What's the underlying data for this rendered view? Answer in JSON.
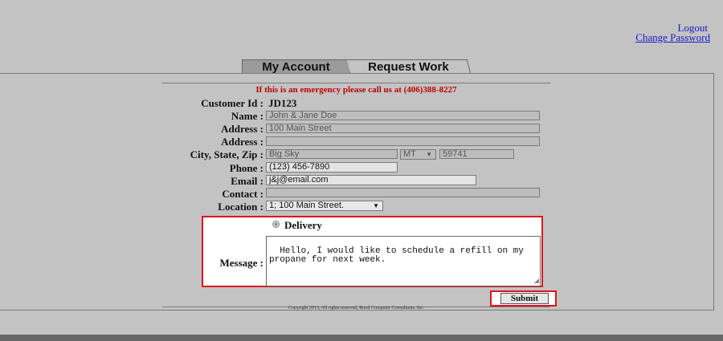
{
  "top_links": {
    "logout": "Logout",
    "change_password": "Change Password"
  },
  "tabs": [
    {
      "label": "My Account",
      "active": false
    },
    {
      "label": "Request Work",
      "active": true
    }
  ],
  "emergency_notice": "If this is an emergency please call us at (406)388-8227",
  "form": {
    "customer_id": {
      "label": "Customer Id :",
      "value": "JD123"
    },
    "name": {
      "label": "Name :",
      "value": "John & Jane Doe"
    },
    "address1": {
      "label": "Address :",
      "value": "100 Main Street"
    },
    "address2": {
      "label": "Address :",
      "value": ""
    },
    "city_state_zip": {
      "label": "City, State, Zip :",
      "city": "Big Sky",
      "state": "MT",
      "zip": "59741"
    },
    "phone": {
      "label": "Phone :",
      "value": "(123) 456-7890"
    },
    "email": {
      "label": "Email :",
      "value": "j&j@email.com"
    },
    "contact": {
      "label": "Contact :",
      "value": ""
    },
    "location": {
      "label": "Location :",
      "value": "1; 100 Main Street."
    },
    "service_type": {
      "label": "Delivery",
      "selected": true
    },
    "message": {
      "label": "Message :",
      "value": "Hello, I would like to schedule a refill on my\npropane for next week."
    }
  },
  "submit_label": "Submit",
  "copyright": "Copyright 2013, All rights reserved, Rural Computer Consultants, Inc.",
  "colors": {
    "background": "#c3c3c3",
    "emergency": "#c00000",
    "highlight": "#e0141c",
    "link": "#1a1ac8"
  },
  "icons": {
    "select_arrow": "chevron-down-icon",
    "radio": "radio-icon"
  }
}
